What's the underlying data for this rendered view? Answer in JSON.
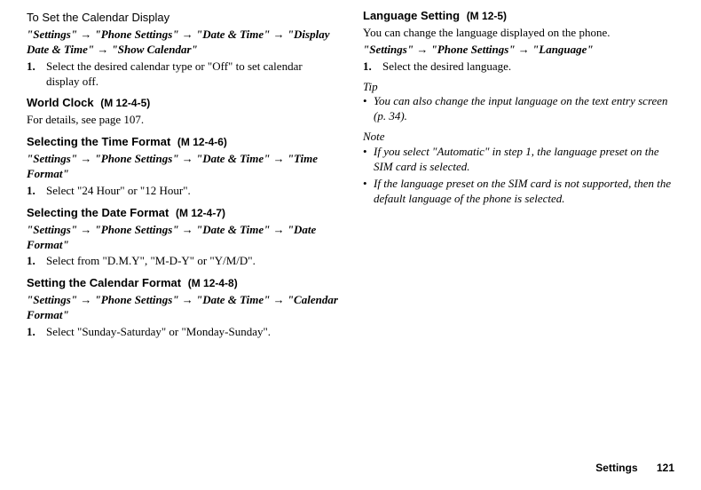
{
  "left": {
    "sec1": {
      "title": "To Set the Calendar Display",
      "path_parts": [
        "\"Settings\"",
        "\"Phone Settings\"",
        "\"Date & Time\"",
        "\"Display Date & Time\"",
        "\"Show Calendar\""
      ],
      "step_num": "1.",
      "step_text": "Select the desired calendar type or \"Off\" to set calendar display off."
    },
    "sec2": {
      "title": "World Clock",
      "menuref": "(M 12-4-5)",
      "desc": "For details, see page 107."
    },
    "sec3": {
      "title": "Selecting the Time Format",
      "menuref": "(M 12-4-6)",
      "path_parts": [
        "\"Settings\"",
        "\"Phone Settings\"",
        "\"Date & Time\"",
        "\"Time Format\""
      ],
      "step_num": "1.",
      "step_text": "Select \"24 Hour\" or \"12 Hour\"."
    },
    "sec4": {
      "title": "Selecting the Date Format",
      "menuref": "(M 12-4-7)",
      "path_parts": [
        "\"Settings\"",
        "\"Phone Settings\"",
        "\"Date & Time\"",
        "\"Date Format\""
      ],
      "step_num": "1.",
      "step_text": "Select from \"D.M.Y\", \"M-D-Y\" or \"Y/M/D\"."
    },
    "sec5": {
      "title": "Setting the Calendar Format",
      "menuref": "(M 12-4-8)",
      "path_parts": [
        "\"Settings\"",
        "\"Phone Settings\"",
        "\"Date & Time\"",
        "\"Calendar Format\""
      ],
      "step_num": "1.",
      "step_text": "Select \"Sunday-Saturday\" or \"Monday-Sunday\"."
    }
  },
  "right": {
    "sec1": {
      "title": "Language Setting",
      "menuref": "(M 12-5)",
      "desc": "You can change the language displayed on the phone.",
      "path_parts": [
        "\"Settings\"",
        "\"Phone Settings\"",
        "\"Language\""
      ],
      "step_num": "1.",
      "step_text": "Select the desired language."
    },
    "tip_label": "Tip",
    "tip_bullet": "You can also change the input language on the text entry screen (p. 34).",
    "note_label": "Note",
    "note_bullets": [
      "If you select \"Automatic\" in step 1, the language preset on the SIM card is selected.",
      "If the language preset on the SIM card is not supported, then the default language of the phone is selected."
    ]
  },
  "arrow": "→",
  "bullet": "•",
  "footer": {
    "section": "Settings",
    "page": "121"
  }
}
